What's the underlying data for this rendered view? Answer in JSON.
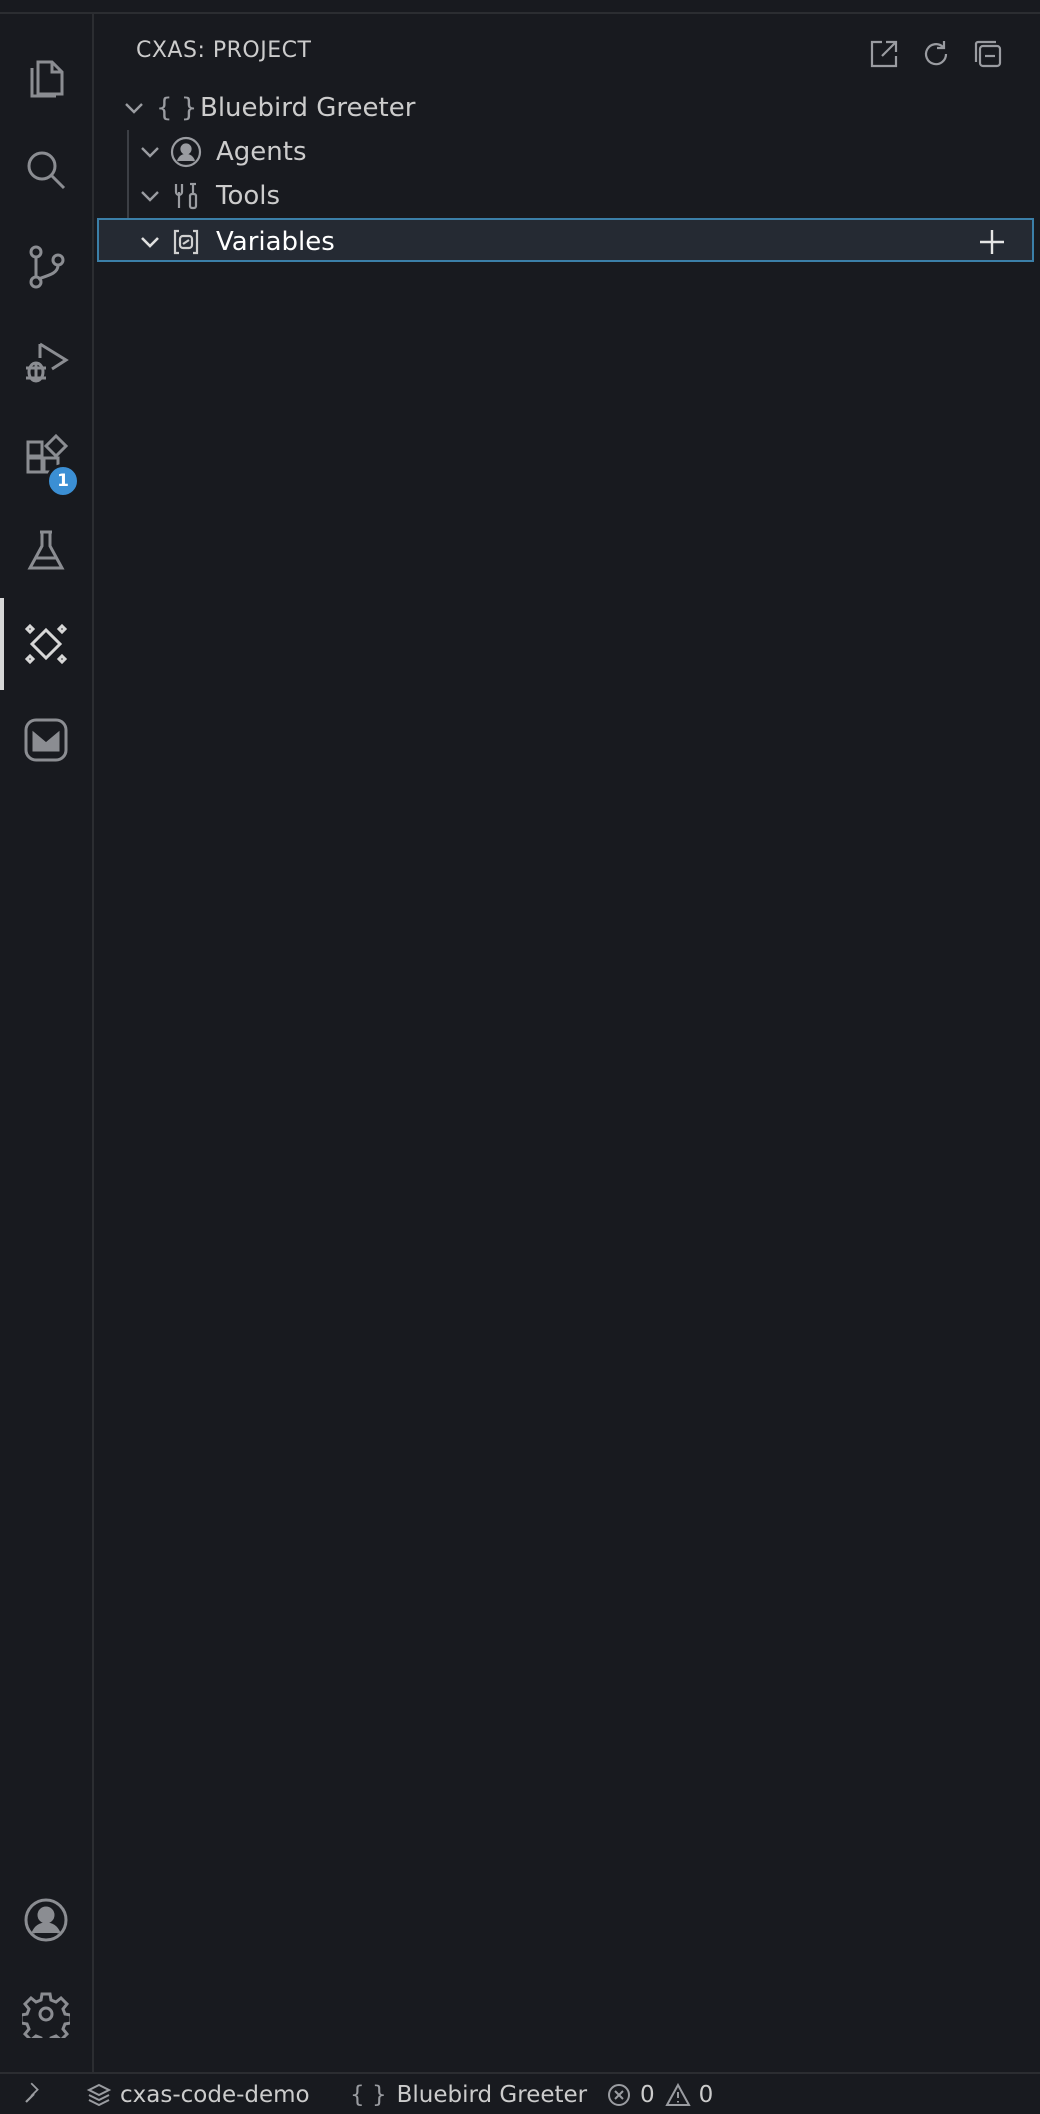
{
  "panel": {
    "title": "CXAS: PROJECT"
  },
  "tree": {
    "root": {
      "brace": "{ }",
      "label": "Bluebird Greeter"
    },
    "children": [
      {
        "label": "Agents"
      },
      {
        "label": "Tools"
      },
      {
        "label": "Variables"
      }
    ]
  },
  "activity": {
    "extensions_badge": "1"
  },
  "statusbar": {
    "workspace": "cxas-code-demo",
    "project_brace": "{ }",
    "project": "Bluebird Greeter",
    "errors": "0",
    "warnings": "0"
  },
  "colors": {
    "background": "#181a1f",
    "selection_bg": "#252a33",
    "selection_border": "#3b7fa8",
    "badge": "#3b8fd4"
  }
}
